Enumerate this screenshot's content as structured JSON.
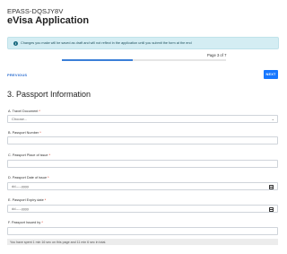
{
  "header": {
    "application_id": "EPASS-DQSJY8V",
    "title": "eVisa Application"
  },
  "banner": {
    "icon": "info-icon",
    "text": "Changes you make will be saved as draft and will not reflect in the application until you submit the form at the end"
  },
  "progress": {
    "page_text": "Page 3 of 7",
    "fraction": 0.43
  },
  "nav": {
    "previous_label": "PREVIOUS",
    "next_label": "NEXT"
  },
  "section": {
    "title": "3. Passport Information"
  },
  "fields": {
    "travel_document": {
      "label": "A. Travel Document",
      "required": "*",
      "value": "Choose..."
    },
    "passport_number": {
      "label": "B. Passport Number",
      "required": "*",
      "value": ""
    },
    "place_of_issue": {
      "label": "C. Passport Place of issue",
      "required": "*",
      "value": ""
    },
    "date_of_issue": {
      "label": "D. Passport Date of issue",
      "required": "*",
      "value": "dd-----yyyy"
    },
    "expiry_date": {
      "label": "E. Passport Expiry date",
      "required": "*",
      "value": "dd-----yyyy"
    },
    "issued_by": {
      "label": "F. Passport Issued by",
      "required": "*",
      "value": ""
    }
  },
  "footer": {
    "timer_text": "You have spent 1 min 16 sec on this page and 11 min 6 sec in total."
  },
  "colors": {
    "accent": "#1677ff",
    "banner_bg": "#d4edf3",
    "required": "#d9230f"
  }
}
